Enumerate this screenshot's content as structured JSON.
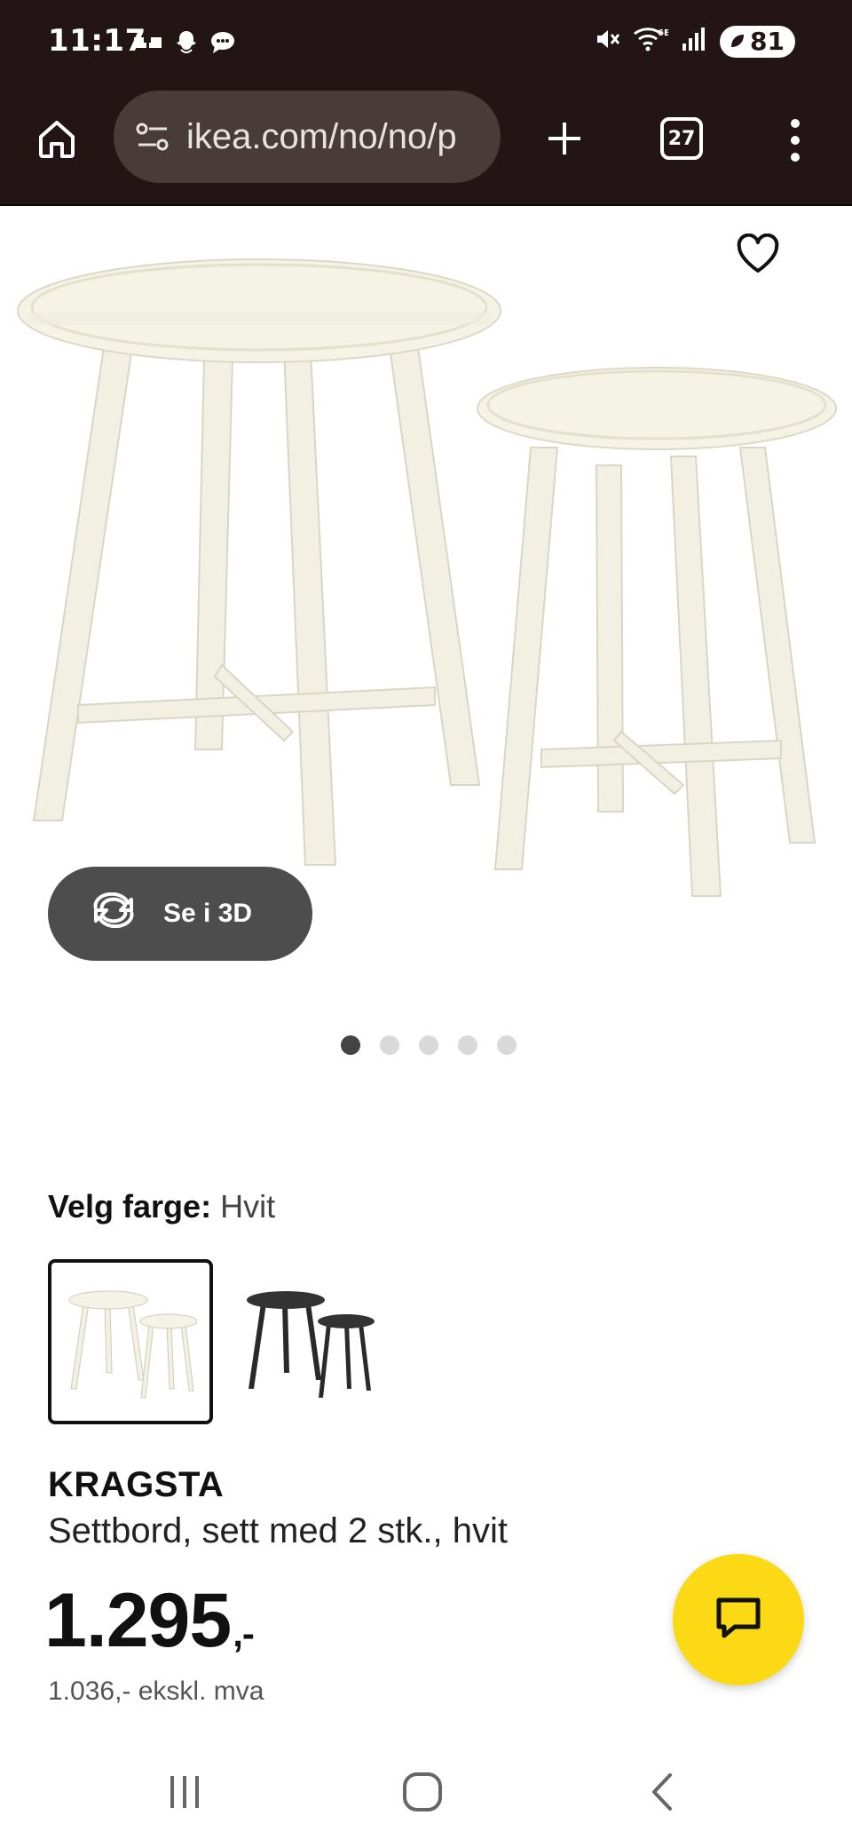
{
  "status_bar": {
    "time": "11:17",
    "battery": "81",
    "left_icons": [
      "gallery-icon",
      "snapchat-icon",
      "messages-icon"
    ],
    "right_icons": [
      "mute-icon",
      "wifi-6e-icon",
      "signal-icon",
      "battery-icon"
    ]
  },
  "browser": {
    "url": "ikea.com/no/no/p",
    "tab_count": "27"
  },
  "product_image": {
    "button_3d": "Se i 3D",
    "dots_total": 5,
    "dots_active_index": 0
  },
  "color": {
    "label": "Velg farge:",
    "value": "Hvit",
    "options": [
      "white",
      "black"
    ],
    "selected": "white"
  },
  "product": {
    "name": "KRAGSTA",
    "description": "Settbord, sett med 2 stk., hvit",
    "price_main": "1.295",
    "price_suffix": ",-",
    "price_ex_vat": "1.036,- ekskl. mva"
  },
  "colors": {
    "brand_yellow": "#fbd914",
    "browser_bg": "#231515"
  }
}
